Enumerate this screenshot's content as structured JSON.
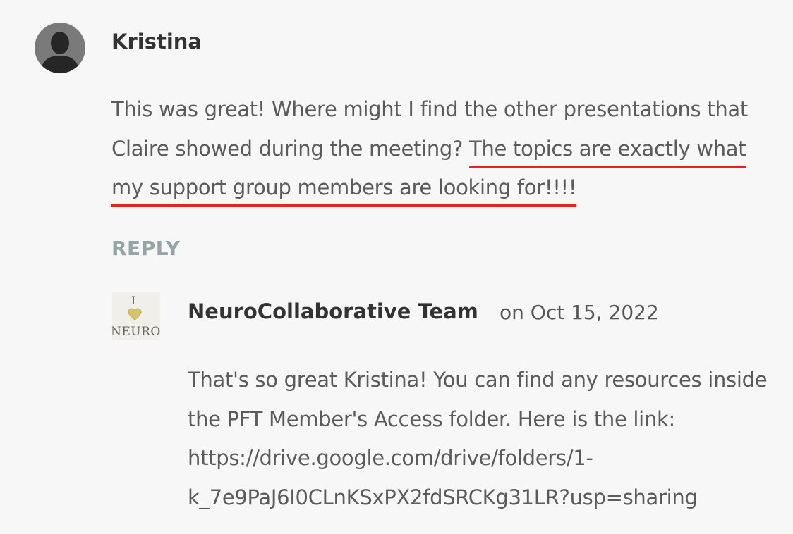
{
  "comment": {
    "author": "Kristina",
    "text_before": "This was great! Where might I find the other presentations that Claire showed during the meeting? ",
    "text_highlighted": "The topics are exactly what my support group members are looking for!!!!",
    "reply_label": "REPLY",
    "highlight_color": "#e3261c"
  },
  "reply": {
    "author": "NeuroCollaborative Team",
    "date": "on Oct 15, 2022",
    "avatar_text": {
      "top": "I",
      "bottom": "NEURO"
    },
    "text_line1": "That's so great Kristina! You can find any resources inside the PFT Member's Access folder. Here is the link:",
    "link": "https://drive.google.com/drive/folders/1-k_7e9PaJ6I0CLnKSxPX2fdSRCKg31LR?usp=sharing"
  },
  "icons": {
    "user_avatar": "person-silhouette-icon",
    "reply_avatar": "heart-icon"
  }
}
